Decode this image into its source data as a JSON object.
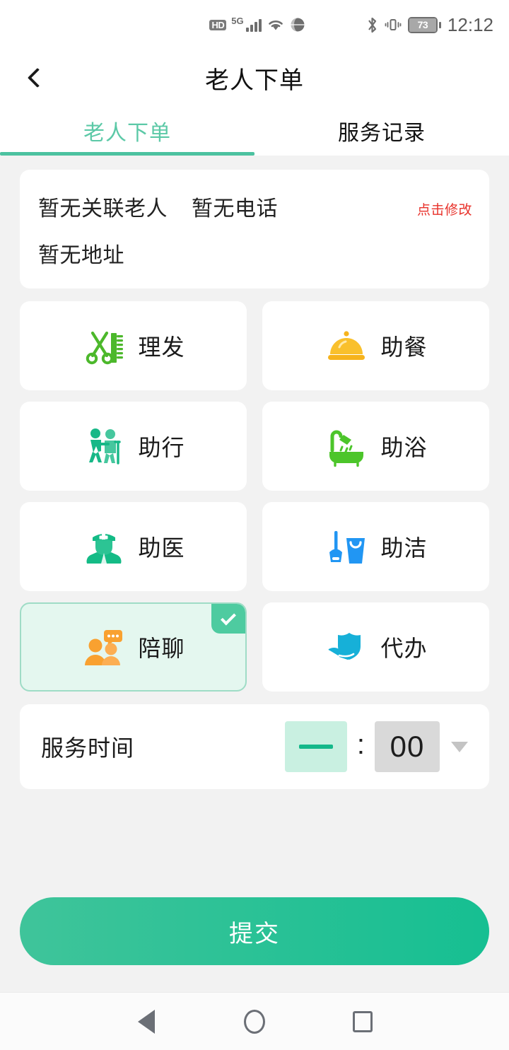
{
  "status_bar": {
    "hd_label": "HD",
    "network_label": "5G",
    "signal_icon": "signal-bars-icon",
    "wifi_icon": "wifi-icon",
    "vpn_icon": "globe-vpn-icon",
    "bluetooth_icon": "bluetooth-icon",
    "vibrate_icon": "vibrate-icon",
    "battery_level": "73",
    "time": "12:12"
  },
  "header": {
    "back_icon": "chevron-left-icon",
    "title": "老人下单"
  },
  "tabs": [
    {
      "label": "老人下单",
      "active": true
    },
    {
      "label": "服务记录",
      "active": false
    }
  ],
  "elder_info": {
    "name": "暂无关联老人",
    "phone": "暂无电话",
    "address": "暂无地址",
    "modify_label": "点击修改",
    "modify_color": "#e8312a"
  },
  "services": [
    {
      "label": "理发",
      "icon": "scissors-comb-icon",
      "color": "#4cb82b",
      "selected": false
    },
    {
      "label": "助餐",
      "icon": "food-cloche-icon",
      "color": "#f6b31c",
      "selected": false
    },
    {
      "label": "助行",
      "icon": "walking-assist-icon",
      "color": "#17b887",
      "selected": false
    },
    {
      "label": "助浴",
      "icon": "bathtub-shower-icon",
      "color": "#4cc52a",
      "selected": false
    },
    {
      "label": "助医",
      "icon": "nurse-icon",
      "color": "#14bb86",
      "selected": false
    },
    {
      "label": "助洁",
      "icon": "mop-bucket-icon",
      "color": "#2196f3",
      "selected": false
    },
    {
      "label": "陪聊",
      "icon": "chat-companion-icon",
      "color": "#f9a130",
      "selected": true
    },
    {
      "label": "代办",
      "icon": "hand-shield-icon",
      "color": "#16b0d8",
      "selected": false
    }
  ],
  "service_time": {
    "label": "服务时间",
    "hour_value": "一",
    "separator": ":",
    "minute_value": "00",
    "dropdown_icon": "caret-down-icon"
  },
  "submit": {
    "label": "提交",
    "color": "#16bf92"
  },
  "nav_bar": {
    "back_icon": "nav-back-triangle-icon",
    "home_icon": "nav-home-circle-icon",
    "recents_icon": "nav-recents-square-icon"
  },
  "theme": {
    "accent": "#4cc2a0",
    "page_bg": "#f2f2f2",
    "card_bg": "#ffffff",
    "selected_bg": "#e4f7ef"
  }
}
